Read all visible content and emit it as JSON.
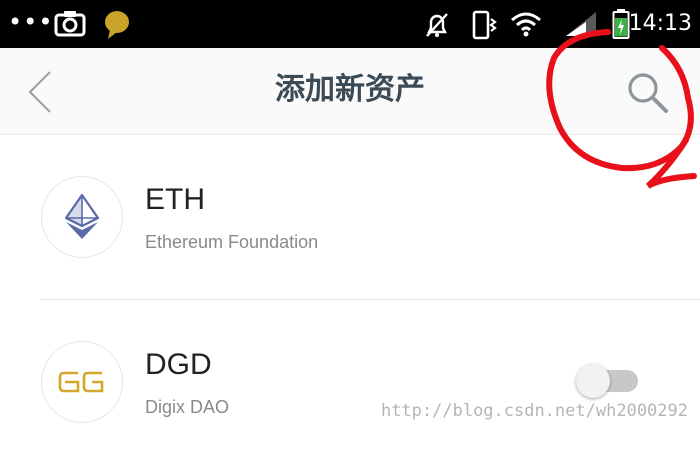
{
  "status_bar": {
    "dots": "•••",
    "time": "14:13",
    "icons": [
      "screenshot-icon",
      "chat-bubble-icon",
      "notifications-muted-icon",
      "vibrate-icon",
      "wifi-icon",
      "signal-icon",
      "battery-charging-icon"
    ]
  },
  "header": {
    "title": "添加新资产",
    "back_icon": "chevron-left-icon",
    "search_icon": "search-icon"
  },
  "assets": [
    {
      "symbol": "ETH",
      "name": "Ethereum Foundation",
      "logo": "ethereum-logo-icon"
    },
    {
      "symbol": "DGD",
      "name": "Digix DAO",
      "logo": "digix-logo-icon",
      "toggle_on": false
    }
  ],
  "colors": {
    "status_bar_bg": "#000000",
    "app_bar_bg": "#fafafa",
    "title_text": "#3b4a55",
    "eth_logo": "#5a6aa8",
    "dgd_logo": "#d4a82a",
    "annotation_red": "#e8101a",
    "chat_bubble": "#c9a22a",
    "battery_green": "#3cb043"
  },
  "watermark": "http://blog.csdn.net/wh2000292"
}
